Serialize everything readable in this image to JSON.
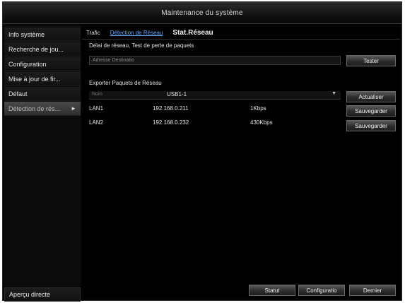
{
  "window": {
    "title": "Maintenance du système"
  },
  "sidebar": {
    "items": [
      {
        "label": "Info système",
        "active": false
      },
      {
        "label": "Recherche de jou...",
        "active": false
      },
      {
        "label": "Configuration",
        "active": false
      },
      {
        "label": "Mise à jour de fir...",
        "active": false
      },
      {
        "label": "Défaut",
        "active": false
      },
      {
        "label": "Détection de rés...",
        "active": true
      }
    ],
    "bottom_label": "Aperçu directe"
  },
  "tabs": [
    "Trafic",
    "Détection de Réseau",
    "Stat.Réseau"
  ],
  "network_test": {
    "title": "Délai de réseau, Test de perte de paquets",
    "address_placeholder": "Adresse Destinatio",
    "test_button": "Tester"
  },
  "export": {
    "title": "Exporter Paquets de Réseau",
    "device_label": "Nom",
    "device_value": "USB1-1",
    "refresh_button": "Actualiser",
    "rows": [
      {
        "name": "LAN1",
        "ip": "192.168.0.211",
        "rate": "1Kbps",
        "button": "Sauvegarder"
      },
      {
        "name": "LAN2",
        "ip": "192.168.0.232",
        "rate": "430Kbps",
        "button": "Sauvegarder"
      }
    ]
  },
  "footer": {
    "status_button": "Statut",
    "config_button": "Configuratio",
    "back_button": "Dernier"
  }
}
